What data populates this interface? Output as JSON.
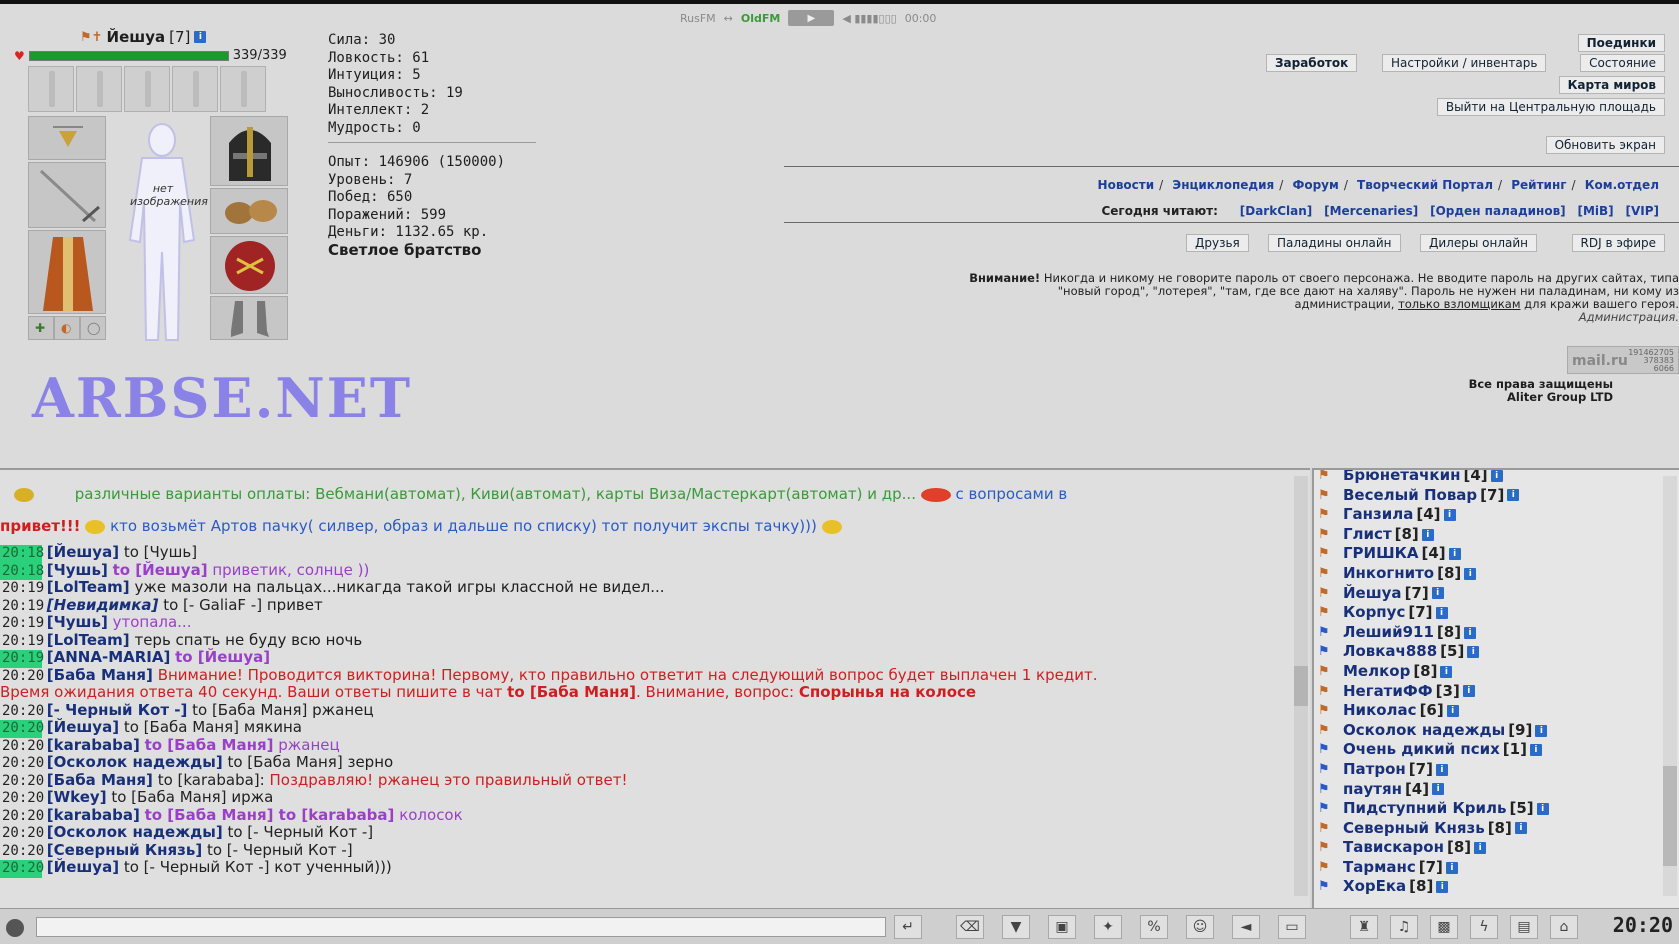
{
  "radio": {
    "left_label": "RusFM",
    "arrow": "↔",
    "right_label": "OldFM",
    "volume": "◀ ▮▮▮▮▯▯▯",
    "time": "00:00"
  },
  "character": {
    "name": "Йешуа",
    "level": "[7]",
    "hp": "339/339",
    "hp_fraction": 1.0,
    "no_image": "нет изображения",
    "stats": [
      "Сила: 30",
      "Ловкость: 61",
      "Интуиция: 5",
      "Выносливость: 19",
      "Интеллект: 2",
      "Мудрость: 0"
    ],
    "progress": [
      "Опыт: 146906 (150000)",
      "Уровень: 7",
      "Побед: 650",
      "Поражений: 599",
      "Деньги: 1132.65 кр."
    ],
    "alignment": "Светлое братство"
  },
  "watermark": "ARBSE.NET",
  "menu": {
    "fights": "Поединки",
    "earnings": "Заработок",
    "settings": "Настройки / инвентарь",
    "status": "Состояние",
    "world_map": "Карта миров",
    "central_square": "Выйти на Центральную площадь",
    "refresh": "Обновить экран"
  },
  "links": [
    "Новости",
    "Энциклопедия",
    "Форум",
    "Творческий Портал",
    "Рейтинг",
    "Ком.отдел"
  ],
  "reading": {
    "label": "Сегодня читают:",
    "clans": [
      "[DarkClan]",
      "[Mercenaries]",
      "[Орден паладинов]",
      "[MiB]",
      "[VIP]"
    ]
  },
  "social_buttons": [
    "Друзья",
    "Паладины онлайн",
    "Дилеры онлайн",
    "RDJ в эфире"
  ],
  "warning": {
    "title": "Внимание!",
    "line1": "Никогда и никому не говорите пароль от своего персонажа. Не вводите пароль на других сайтах, типа",
    "line2": "\"новый город\", \"лотерея\", \"там, где все дают на халяву\". Пароль не нужен ни паладинам, ни кому из",
    "line3_pre": "администрации,",
    "line3_link": "только взломщикам",
    "line3_post": "для кражи вашего героя.",
    "signature": "Администрация."
  },
  "counter": {
    "mail": "mail.ru",
    "n1": "191462705",
    "n2": "378383",
    "n3": "6066"
  },
  "copyright": {
    "line1": "Все права защищены",
    "line2": "Aliter Group LTD"
  },
  "chat": {
    "ad_line": "различные варианты оплаты: Вебмани(автомат), Киви(автомат), карты Виза/Мастеркарт(автомат) и др...",
    "ad_tail": "с вопросами в",
    "promo_pre": "привет!!!",
    "promo_text": "кто возьмёт Артов пачку( силвер, образ и дальше по списку) тот получит экспы тачку)))",
    "lines": [
      {
        "ts": "20:18",
        "hl": true,
        "nick": "[Йешуа]",
        "to": "to [Чушь]",
        "text": ""
      },
      {
        "ts": "20:18",
        "hl": true,
        "nick": "[Чушь]",
        "to": "to [Йешуа]",
        "text": "приветик, солнце ))",
        "style": "priv"
      },
      {
        "ts": "20:19",
        "hl": false,
        "nick": "[LolTeam]",
        "to": "",
        "text": "уже мазоли на пальцах...никагда такой игры классной не видел..."
      },
      {
        "ts": "20:19",
        "hl": false,
        "nick": "[Невидимка]",
        "to": "to [- GaliaF -]",
        "text": "привет",
        "italic": true
      },
      {
        "ts": "20:19",
        "hl": false,
        "nick": "[Чушь]",
        "to": "",
        "text": "утопала...",
        "style": "priv"
      },
      {
        "ts": "20:19",
        "hl": false,
        "nick": "[LolTeam]",
        "to": "",
        "text": "терь спать не буду всю ночь"
      },
      {
        "ts": "20:19",
        "hl": true,
        "nick": "[ANNA-MARIA]",
        "to": "to [Йешуа]",
        "text": "",
        "style": "privb"
      },
      {
        "ts": "20:20",
        "hl": false,
        "nick": "[Баба Маня]",
        "to": "",
        "text": "Внимание! Проводится викторина! Первому, кто правильно ответит на следующий вопрос будет выплачен 1 кредит.",
        "style": "red"
      }
    ],
    "quiz_line": {
      "pre": "Время ожидания ответа 40 секунд. Ваши ответы пишите в чат",
      "target": "to [Баба Маня]",
      "mid": ". Внимание, вопрос:",
      "question": "Спорынья на колосе"
    },
    "lines2": [
      {
        "ts": "20:20",
        "hl": false,
        "nick": "[- Черный Кот -]",
        "to": "to [Баба Маня]",
        "text": "ржанец"
      },
      {
        "ts": "20:20",
        "hl": true,
        "nick": "[Йешуа]",
        "to": "to [Баба Маня]",
        "text": "мякина"
      },
      {
        "ts": "20:20",
        "hl": false,
        "nick": "[karababa]",
        "to": "to [Баба Маня]",
        "text": "ржанец",
        "style": "priv"
      },
      {
        "ts": "20:20",
        "hl": false,
        "nick": "[Осколок надежды]",
        "to": "to [Баба Маня]",
        "text": "зерно"
      },
      {
        "ts": "20:20",
        "hl": false,
        "nick": "[Баба Маня]",
        "to": "to [karababa]:",
        "text": "Поздравляю! ржанец это правильный ответ!",
        "style": "red"
      },
      {
        "ts": "20:20",
        "hl": false,
        "nick": "[Wkey]",
        "to": "to [Баба Маня]",
        "text": "иржа"
      },
      {
        "ts": "20:20",
        "hl": false,
        "nick": "[karababa]",
        "to": "to [Баба Маня] to [karababa]",
        "text": "колосок",
        "style": "priv"
      },
      {
        "ts": "20:20",
        "hl": false,
        "nick": "[Осколок надежды]",
        "to": "to [- Черный Кот -]",
        "text": ""
      },
      {
        "ts": "20:20",
        "hl": false,
        "nick": "[Северный Князь]",
        "to": "to [- Черный Кот -]",
        "text": ""
      },
      {
        "ts": "20:20",
        "hl": true,
        "nick": "[Йешуа]",
        "to": "to [- Черный Кот -]",
        "text": "кот ученный)))"
      }
    ]
  },
  "users": [
    {
      "name": "Брюнетачкин",
      "level": "[4]",
      "side": "orange"
    },
    {
      "name": "Веселый Повар",
      "level": "[7]",
      "side": "orange"
    },
    {
      "name": "Ганзила",
      "level": "[4]",
      "side": "orange"
    },
    {
      "name": "Глист",
      "level": "[8]",
      "side": "orange"
    },
    {
      "name": "ГРИШКА",
      "level": "[4]",
      "side": "orange"
    },
    {
      "name": "Инкогнито",
      "level": "[8]",
      "side": "orange"
    },
    {
      "name": "Йешуа",
      "level": "[7]",
      "side": "orange"
    },
    {
      "name": "Корпус",
      "level": "[7]",
      "side": "orange"
    },
    {
      "name": "Леший911",
      "level": "[8]",
      "side": "blue"
    },
    {
      "name": "Ловкач888",
      "level": "[5]",
      "side": "blue"
    },
    {
      "name": "Мелкор",
      "level": "[8]",
      "side": "orange"
    },
    {
      "name": "НегатиФФ",
      "level": "[3]",
      "side": "orange"
    },
    {
      "name": "Николас",
      "level": "[6]",
      "side": "orange"
    },
    {
      "name": "Осколок надежды",
      "level": "[9]",
      "side": "orange"
    },
    {
      "name": "Очень дикий псих",
      "level": "[1]",
      "side": "blue"
    },
    {
      "name": "Патрон",
      "level": "[7]",
      "side": "blue"
    },
    {
      "name": "паутян",
      "level": "[4]",
      "side": "blue"
    },
    {
      "name": "Пидступний Криль",
      "level": "[5]",
      "side": "blue"
    },
    {
      "name": "Северный Князь",
      "level": "[8]",
      "side": "orange"
    },
    {
      "name": "Тавискарон",
      "level": "[8]",
      "side": "orange"
    },
    {
      "name": "Тарманс",
      "level": "[7]",
      "side": "orange"
    },
    {
      "name": "ХорЕка",
      "level": "[8]",
      "side": "blue"
    }
  ],
  "toolbar": {
    "clock": "20:20"
  }
}
